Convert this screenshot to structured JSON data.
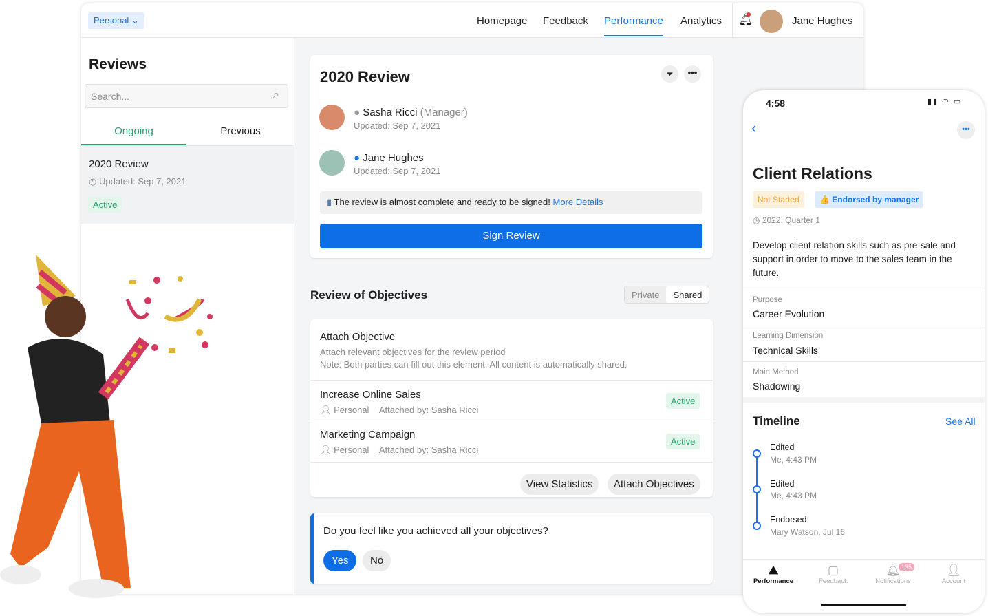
{
  "header": {
    "workspace": "Personal",
    "nav": [
      "Homepage",
      "Feedback",
      "Performance",
      "Analytics"
    ],
    "active": "Performance",
    "user": "Jane Hughes"
  },
  "sidebar": {
    "title": "Reviews",
    "search_placeholder": "Search...",
    "tabs": [
      "Ongoing",
      "Previous"
    ],
    "item": {
      "title": "2020 Review",
      "updated": "Updated: Sep 7, 2021",
      "status": "Active"
    }
  },
  "review": {
    "title": "2020 Review",
    "people": [
      {
        "name": "Sasha Ricci",
        "role": "(Manager)",
        "updated": "Updated: Sep 7, 2021",
        "dot": "#9a9a9a"
      },
      {
        "name": "Jane Hughes",
        "role": "",
        "updated": "Updated: Sep 7, 2021",
        "dot": "#1a73e8"
      }
    ],
    "notice": "The review is almost complete and ready to be signed!",
    "notice_link": "More Details",
    "sign": "Sign Review"
  },
  "objectives": {
    "title": "Review of Objectives",
    "toggle": [
      "Private",
      "Shared"
    ],
    "attach_title": "Attach Objective",
    "attach_desc": "Attach relevant objectives for the review period",
    "attach_note": "Note: Both parties can fill out this element. All content is automatically shared.",
    "items": [
      {
        "title": "Increase Online Sales",
        "type": "Personal",
        "by": "Attached by: Sasha Ricci",
        "status": "Active"
      },
      {
        "title": "Marketing Campaign",
        "type": "Personal",
        "by": "Attached by: Sasha Ricci",
        "status": "Active"
      }
    ],
    "buttons": [
      "View Statistics",
      "Attach Objectives"
    ]
  },
  "question": {
    "text": "Do you feel like you achieved all your objectives?",
    "yes": "Yes",
    "no": "No"
  },
  "phone": {
    "time": "4:58",
    "title": "Client Relations",
    "badges": [
      "Not Started",
      "Endorsed by manager"
    ],
    "period": "2022, Quarter 1",
    "desc": "Develop client relation skills such as pre-sale and support in order to move to the sales team in the future.",
    "fields": [
      {
        "label": "Purpose",
        "value": "Career Evolution"
      },
      {
        "label": "Learning Dimension",
        "value": "Technical Skills"
      },
      {
        "label": "Main Method",
        "value": "Shadowing"
      }
    ],
    "timeline_title": "Timeline",
    "see_all": "See All",
    "timeline": [
      {
        "event": "Edited",
        "meta": "Me, 4:43 PM"
      },
      {
        "event": "Edited",
        "meta": "Me, 4:43 PM"
      },
      {
        "event": "Endorsed",
        "meta": "Mary Watson, Jul 16"
      }
    ],
    "tabs": [
      "Performance",
      "Feedback",
      "Notifications",
      "Account"
    ],
    "notif_count": "135"
  }
}
